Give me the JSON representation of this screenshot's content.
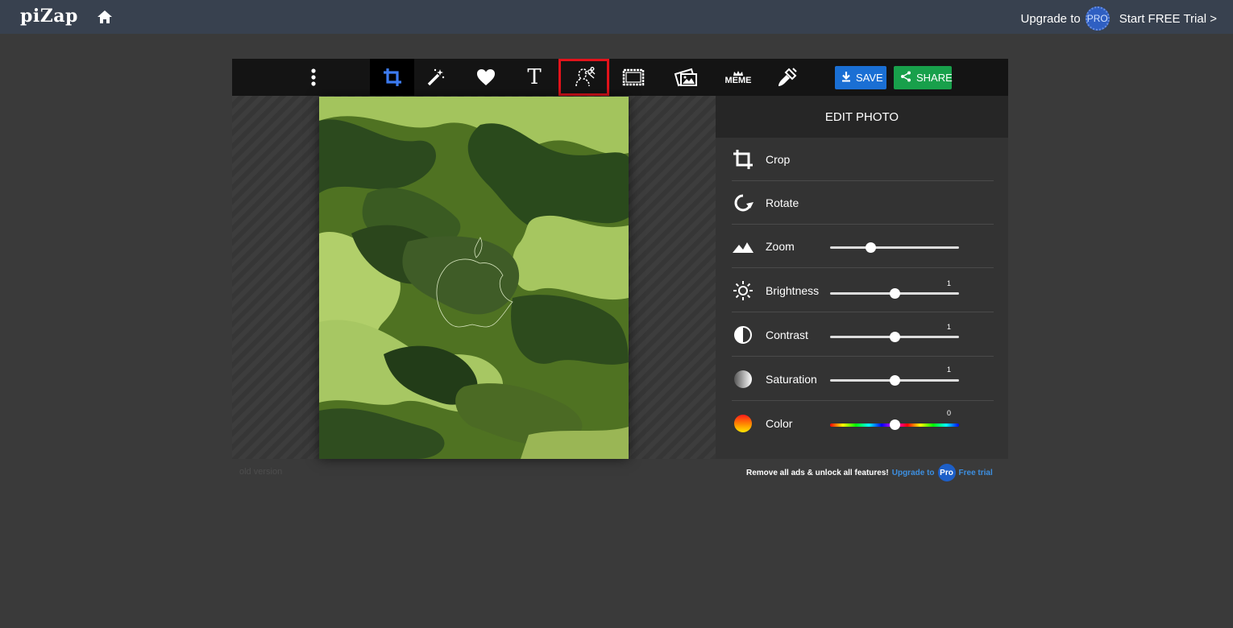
{
  "topbar": {
    "logo": "piZap",
    "upgrade_text": "Upgrade to",
    "pro_badge": "PRO",
    "trial_link": "Start FREE Trial >"
  },
  "toolbar": {
    "tools": [
      {
        "name": "more-menu",
        "icon": "vertical-dots-icon"
      },
      {
        "name": "crop",
        "icon": "crop-icon",
        "active": true
      },
      {
        "name": "effects",
        "icon": "magic-wand-icon"
      },
      {
        "name": "stickers",
        "icon": "heart-icon"
      },
      {
        "name": "text",
        "icon": "text-icon",
        "label": "T"
      },
      {
        "name": "cutout",
        "icon": "cutout-icon",
        "highlighted": true
      },
      {
        "name": "borders",
        "icon": "border-frame-icon"
      },
      {
        "name": "collage",
        "icon": "photo-collage-icon"
      },
      {
        "name": "meme",
        "icon": "meme-icon",
        "label": "MEME"
      },
      {
        "name": "paint",
        "icon": "paint-brush-icon"
      }
    ],
    "save_label": "SAVE",
    "share_label": "SHARE"
  },
  "panel": {
    "title": "EDIT PHOTO",
    "rows": [
      {
        "label": "Crop",
        "icon": "crop-icon"
      },
      {
        "label": "Rotate",
        "icon": "rotate-icon"
      },
      {
        "label": "Zoom",
        "icon": "mountain-icon",
        "slider": 0.31
      },
      {
        "label": "Brightness",
        "icon": "sun-icon",
        "slider": 0.5,
        "value": "1"
      },
      {
        "label": "Contrast",
        "icon": "contrast-icon",
        "slider": 0.5,
        "value": "1"
      },
      {
        "label": "Saturation",
        "icon": "saturation-icon",
        "slider": 0.5,
        "value": "1"
      },
      {
        "label": "Color",
        "icon": "color-wheel-icon",
        "slider": 0.5,
        "value": "0"
      }
    ]
  },
  "footer": {
    "old_version": "old version",
    "promo_text": "Remove all ads & unlock all features!",
    "upgrade_link": "Upgrade to",
    "pro_badge": "Pro",
    "trial_link": "Free trial"
  },
  "colors": {
    "topbar": "#38414f",
    "background": "#3a3a3a",
    "save": "#1a6fd4",
    "share": "#18a04b",
    "highlight": "#e3131b",
    "active_tool": "#3d7bf0"
  }
}
